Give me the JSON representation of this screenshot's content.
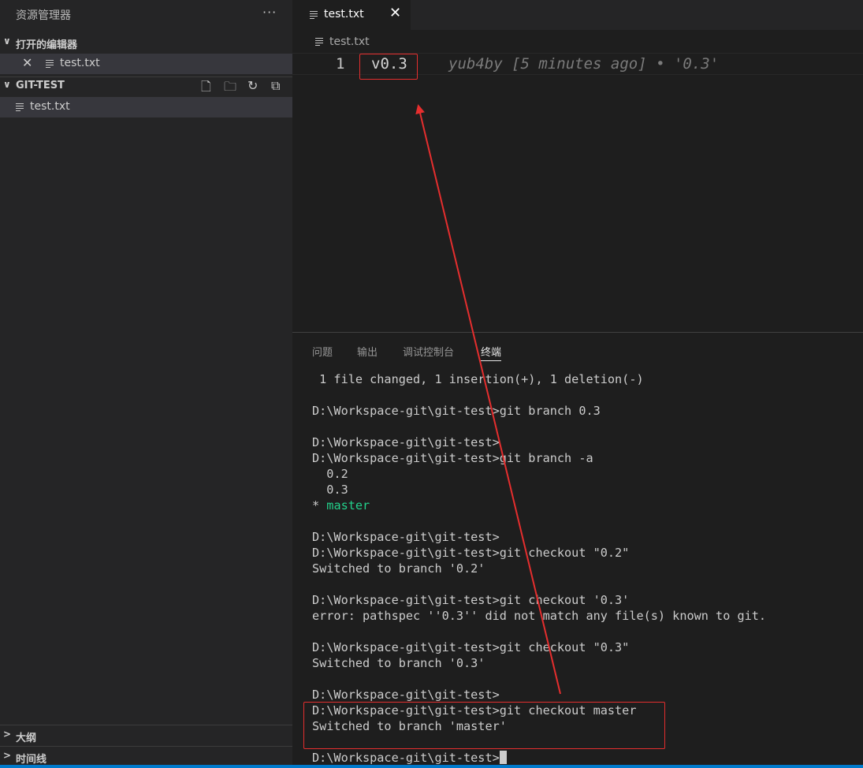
{
  "sidebar": {
    "title": "资源管理器",
    "more_label": "···",
    "open_editors_label": "打开的编辑器",
    "open_editor_file": "test.txt",
    "workspace_label": "GIT-TEST",
    "workspace_file": "test.txt",
    "outline_label": "大纲",
    "timeline_label": "时间线"
  },
  "editor": {
    "tab_label": "test.txt",
    "breadcrumb": "test.txt",
    "line_number": "1",
    "line_text": "v0.3",
    "blame_text": "yub4by [5 minutes ago] • '0.3'"
  },
  "panel": {
    "tabs": [
      "问题",
      "输出",
      "调试控制台",
      "终端"
    ],
    "active_tab": "终端",
    "terminal_lines": [
      " 1 file changed, 1 insertion(+), 1 deletion(-)",
      "",
      "D:\\Workspace-git\\git-test>git branch 0.3",
      "",
      "D:\\Workspace-git\\git-test>",
      "D:\\Workspace-git\\git-test>git branch -a",
      "  0.2",
      "  0.3",
      "* master",
      "",
      "D:\\Workspace-git\\git-test>",
      "D:\\Workspace-git\\git-test>git checkout \"0.2\"",
      "Switched to branch '0.2'",
      "",
      "D:\\Workspace-git\\git-test>git checkout '0.3'",
      "error: pathspec ''0.3'' did not match any file(s) known to git.",
      "",
      "D:\\Workspace-git\\git-test>git checkout \"0.3\"",
      "Switched to branch '0.3'",
      "",
      "D:\\Workspace-git\\git-test>",
      "D:\\Workspace-git\\git-test>git checkout master",
      "Switched to branch 'master'",
      "",
      "D:\\Workspace-git\\git-test>"
    ]
  },
  "colors": {
    "annotation": "#e52e2e",
    "branch_current": "#23d18b",
    "status_bar": "#007acc"
  }
}
